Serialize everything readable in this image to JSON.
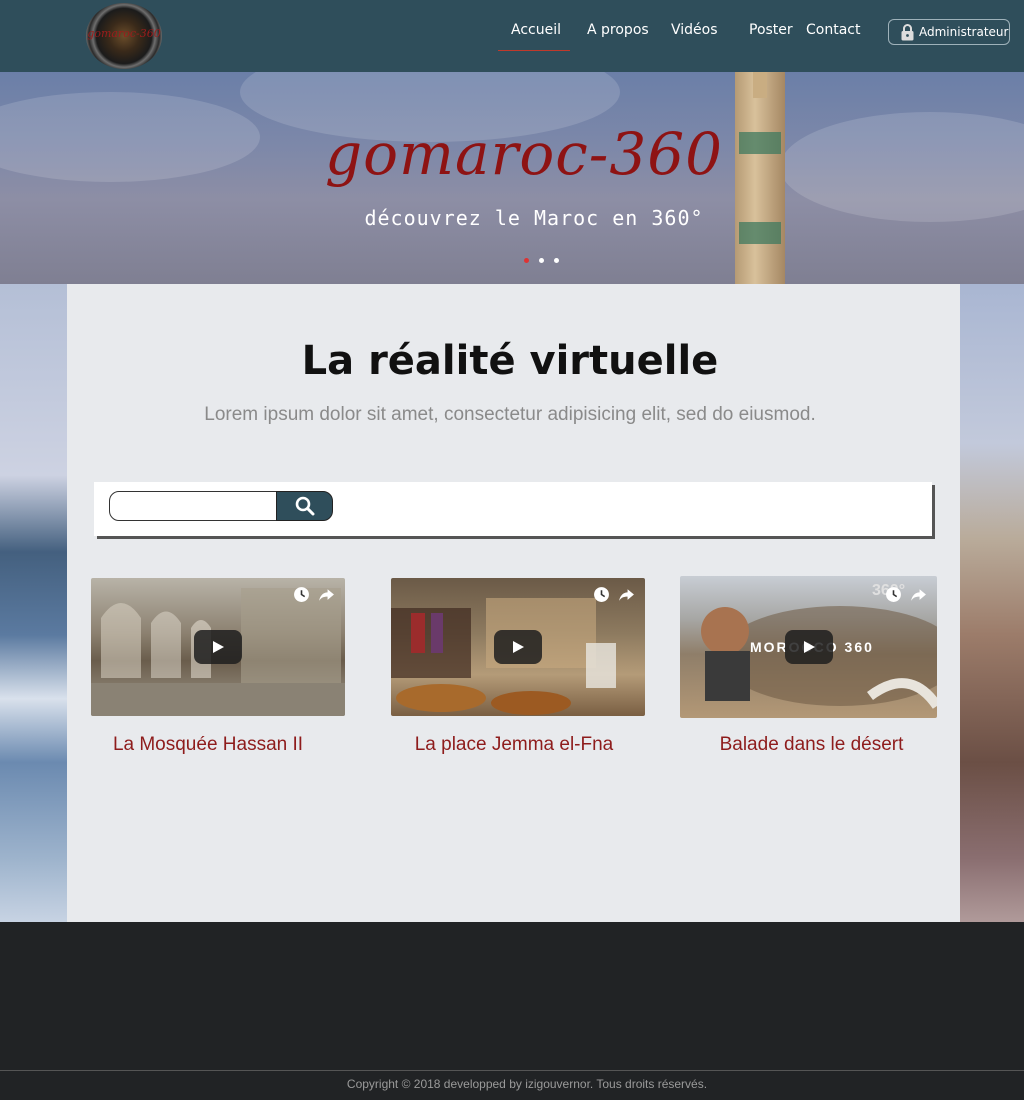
{
  "brand": {
    "logo_text": "gomaroc-360"
  },
  "nav": {
    "items": [
      {
        "label": "Accueil",
        "active": true
      },
      {
        "label": "A propos"
      },
      {
        "label": "Vidéos"
      },
      {
        "label": "Poster"
      },
      {
        "label": "Contact"
      }
    ],
    "admin_label": "Administrateur",
    "admin_icon": "lock-icon"
  },
  "hero": {
    "title": "gomaroc-360",
    "subtitle": "découvrez le Maroc en 360°",
    "slides_count": 3,
    "active_slide": 0
  },
  "section": {
    "title": "La réalité virtuelle",
    "subtitle": "Lorem ipsum dolor sit amet, consectetur adipisicing elit, sed do eiusmod."
  },
  "search": {
    "placeholder": "",
    "button_icon": "search-icon"
  },
  "videos": [
    {
      "title": "La Mosquée Hassan II"
    },
    {
      "title": "La place Jemma el-Fna"
    },
    {
      "title": "Balade dans le désert",
      "overlay_text": "MOROCCO 360",
      "badge": "360°"
    }
  ],
  "footer": {
    "copyright": "Copyright © 2018 developped by izigouvernor. Tous droits réservés."
  },
  "colors": {
    "navbar": "#2f4e5b",
    "accent": "#8e1313",
    "footer": "#212325"
  }
}
